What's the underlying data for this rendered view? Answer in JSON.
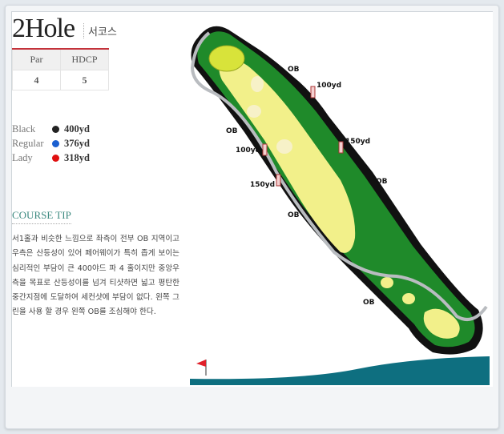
{
  "hole": {
    "title": "2Hole",
    "course": "서코스"
  },
  "info": {
    "headers": [
      "Par",
      "HDCP"
    ],
    "values": [
      "4",
      "5"
    ]
  },
  "tees": [
    {
      "name": "Black",
      "color": "#222222",
      "yards": "400yd"
    },
    {
      "name": "Regular",
      "color": "#1a5fd0",
      "yards": "376yd"
    },
    {
      "name": "Lady",
      "color": "#e01010",
      "yards": "318yd"
    }
  ],
  "tip": {
    "heading": "COURSE TIP",
    "text": "서1홀과 비슷한 느낌으로 좌측이 전부 OB 지역이고 우측은 산등성이 있어 페어웨이가 특히 좁게 보이는 심리적인 부담이 큰 400야드 파 4 홀이지만 중앙우측을 목표로 산등성이를 넘겨 티샷하면 넓고 평탄한 중간지점에 도달하여 세컨샷에 부담이 없다. 왼쪽 그린을 사용 할 경우 왼쪽 OB를 조심해야 한다."
  },
  "map": {
    "labels": {
      "ob1": "OB",
      "ob2": "OB",
      "ob3": "OB",
      "ob4": "OB",
      "ob5": "OB",
      "m100a": "100yd",
      "m150a": "150yd",
      "m100b": "100yd",
      "m150b": "150yd"
    },
    "colors": {
      "rough": "#1f8a2a",
      "fairway": "#f2f08a",
      "green": "#d8e33a",
      "water": "#0e6f80",
      "flag": "#e0202a"
    }
  }
}
